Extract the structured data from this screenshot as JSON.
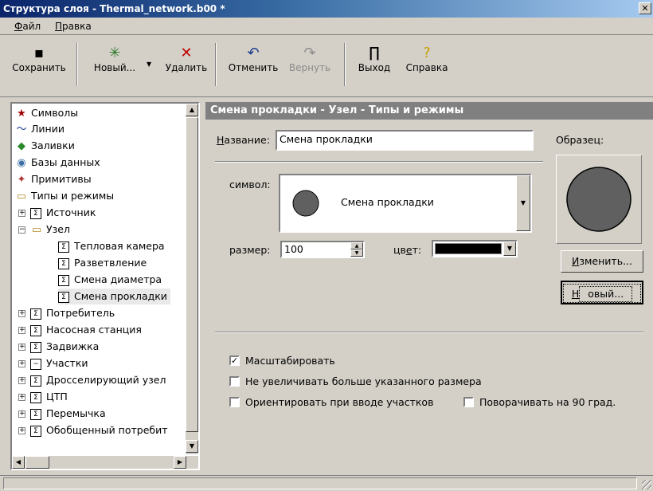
{
  "window": {
    "title": "Структура слоя - Thermal_network.b00 *",
    "close_glyph": "✕"
  },
  "menu": [
    {
      "accel": "Ф",
      "rest": "айл"
    },
    {
      "accel": "П",
      "rest": "равка"
    }
  ],
  "toolbar": {
    "save": "Сохранить",
    "new": "Новый...",
    "delete": "Удалить",
    "undo": "Отменить",
    "redo": "Вернуть",
    "exit": "Выход",
    "help": "Справка"
  },
  "tree": [
    {
      "label": "Символы",
      "icon": "star-icon"
    },
    {
      "label": "Линии",
      "icon": "line-icon"
    },
    {
      "label": "Заливки",
      "icon": "fill-icon"
    },
    {
      "label": "Базы данных",
      "icon": "database-icon"
    },
    {
      "label": "Примитивы",
      "icon": "primitives-icon"
    },
    {
      "label": "Типы и режимы",
      "icon": "folder-open-icon"
    },
    {
      "label": "Источник",
      "icon": "type-icon"
    },
    {
      "label": "Узел",
      "icon": "folder-open-icon"
    },
    {
      "label": "Тепловая камера",
      "icon": "type-icon"
    },
    {
      "label": "Разветвление",
      "icon": "type-icon"
    },
    {
      "label": "Смена диаметра",
      "icon": "type-icon"
    },
    {
      "label": "Смена прокладки",
      "icon": "type-icon"
    },
    {
      "label": "Потребитель",
      "icon": "type-icon"
    },
    {
      "label": "Насосная станция",
      "icon": "type-icon"
    },
    {
      "label": "Задвижка",
      "icon": "type-icon"
    },
    {
      "label": "Участки",
      "icon": "line-type-icon"
    },
    {
      "label": "Дросселирующий узел",
      "icon": "type-icon"
    },
    {
      "label": "ЦТП",
      "icon": "type-icon"
    },
    {
      "label": "Перемычка",
      "icon": "type-icon"
    },
    {
      "label": "Обобщенный потребит",
      "icon": "type-icon"
    }
  ],
  "panel": {
    "header": "Смена прокладки - Узел - Типы и режимы",
    "name_label_accel": "Н",
    "name_label_rest": "азвание:",
    "name_value": "Смена прокладки",
    "sample_label": "Образец:",
    "symbol_label": "символ:",
    "symbol_value": "Смена прокладки",
    "size_label": "размер:",
    "size_value": "100",
    "color_label_pre": "цв",
    "color_label_accel": "е",
    "color_label_post": "т:",
    "color_value": "#000000",
    "symbol_color": "#606060",
    "change_button_accel": "И",
    "change_button_rest": "зменить...",
    "new_button_accel": "Н",
    "new_button_rest": "овый...",
    "scale_label": "Масштабировать",
    "scale_checked": true,
    "no_enlarge_label": "Не увеличивать больше указанного размера",
    "no_enlarge_checked": false,
    "orient_label": "Ориентировать при вводе участков",
    "orient_checked": false,
    "rotate_label": "Поворачивать на 90 град.",
    "rotate_checked": false
  }
}
